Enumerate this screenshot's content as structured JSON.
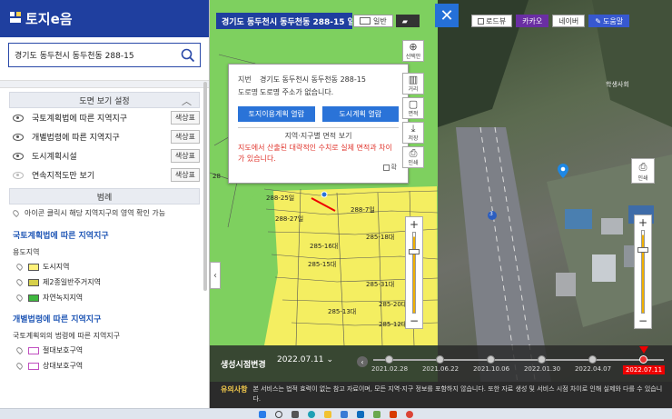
{
  "app": {
    "logo_text": "토지e음",
    "logo_mark": "e음"
  },
  "search": {
    "value": "경기도 동두천시 동두천동 288-15"
  },
  "view_settings": {
    "title": "도면 보기 설정",
    "layers": [
      {
        "label": "국토계획법에 따른 지역지구",
        "button": "색상표",
        "visible": true
      },
      {
        "label": "개별법령에 따른 지역지구",
        "button": "색상표",
        "visible": true
      },
      {
        "label": "도시계획시설",
        "button": "색상표",
        "visible": true
      },
      {
        "label": "연속지적도만 보기",
        "button": "색상표",
        "visible": false
      }
    ]
  },
  "legend": {
    "title": "범례",
    "tip": "아이콘 클릭시 해당 지역지구의 영역 확인 가능",
    "group1_title": "국토계획법에 따른 지역지구",
    "group1_sub": "용도지역",
    "group1_items": [
      {
        "label": "도시지역",
        "color": "#fff27a"
      },
      {
        "label": "제2종일반주거지역",
        "color": "#d6d04a"
      },
      {
        "label": "자연녹지지역",
        "color": "#3fb83f"
      }
    ],
    "group2_title": "개별법령에 따른 지역지구",
    "group2_sub": "국토계획외의 법령에 따른 지역지구",
    "group2_items": [
      {
        "label": "절대보호구역",
        "color": "#c04fc0"
      },
      {
        "label": "상대보호구역",
        "color": "#c04fc0"
      }
    ]
  },
  "map": {
    "address_title": "경기도 동두천시 동두천동 288-15 일",
    "basemap": {
      "general": "일반",
      "roadview": "로드뷰",
      "kakao": "카카오",
      "naver": "네이버",
      "help": "도움말"
    },
    "close_icon": "close-icon",
    "tools_left": [
      {
        "glyph": "⊕",
        "label": "선택안"
      },
      {
        "glyph": "▥",
        "label": "거리"
      },
      {
        "glyph": "▢",
        "label": "면적"
      },
      {
        "glyph": "⤓",
        "label": "저장"
      },
      {
        "glyph": "⎙",
        "label": "인쇄"
      }
    ],
    "print_right": {
      "glyph": "⎙",
      "label": "인쇄"
    },
    "parcels": [
      "288-25일",
      "288-7일",
      "288-27일",
      "285-16대",
      "285-18대",
      "285-15대",
      "285-31대",
      "285-13대",
      "285-20대",
      "285-12대"
    ],
    "parcel_partial": "28",
    "road_label": "3",
    "place_label": "학생사회"
  },
  "popup": {
    "jibun_label": "지번",
    "jibun_value": "경기도 동두천시 동두천동 288-15",
    "road_label": "도로명",
    "road_value": "도로명 주소가 없습니다.",
    "btn_land_plan": "토지이용계획 열람",
    "btn_city_plan": "도시계획 열람",
    "area_title": "지역·지구별 면적 보기",
    "warning": "지도에서 산출된 대략적인 수치로 실제 면적과 차이가 있습니다.",
    "check_label": "확"
  },
  "timeline": {
    "label": "생성시점변경",
    "selected": "2022.07.11",
    "dates": [
      "2021.02.28",
      "2021.06.22",
      "2021.10.06",
      "2022.01.30",
      "2022.04.07",
      "2022.07.11"
    ],
    "active_date": "2022.07.11"
  },
  "notice": {
    "tag": "유의사항",
    "text": "본 서비스는 법적 효력이 없는 참고 자료이며, 모든 지역·지구 정보를 포함하지 않습니다. 또한 자료 생성 및 서비스 시점 차이로 인해 실제와 다를 수 있습니다."
  }
}
